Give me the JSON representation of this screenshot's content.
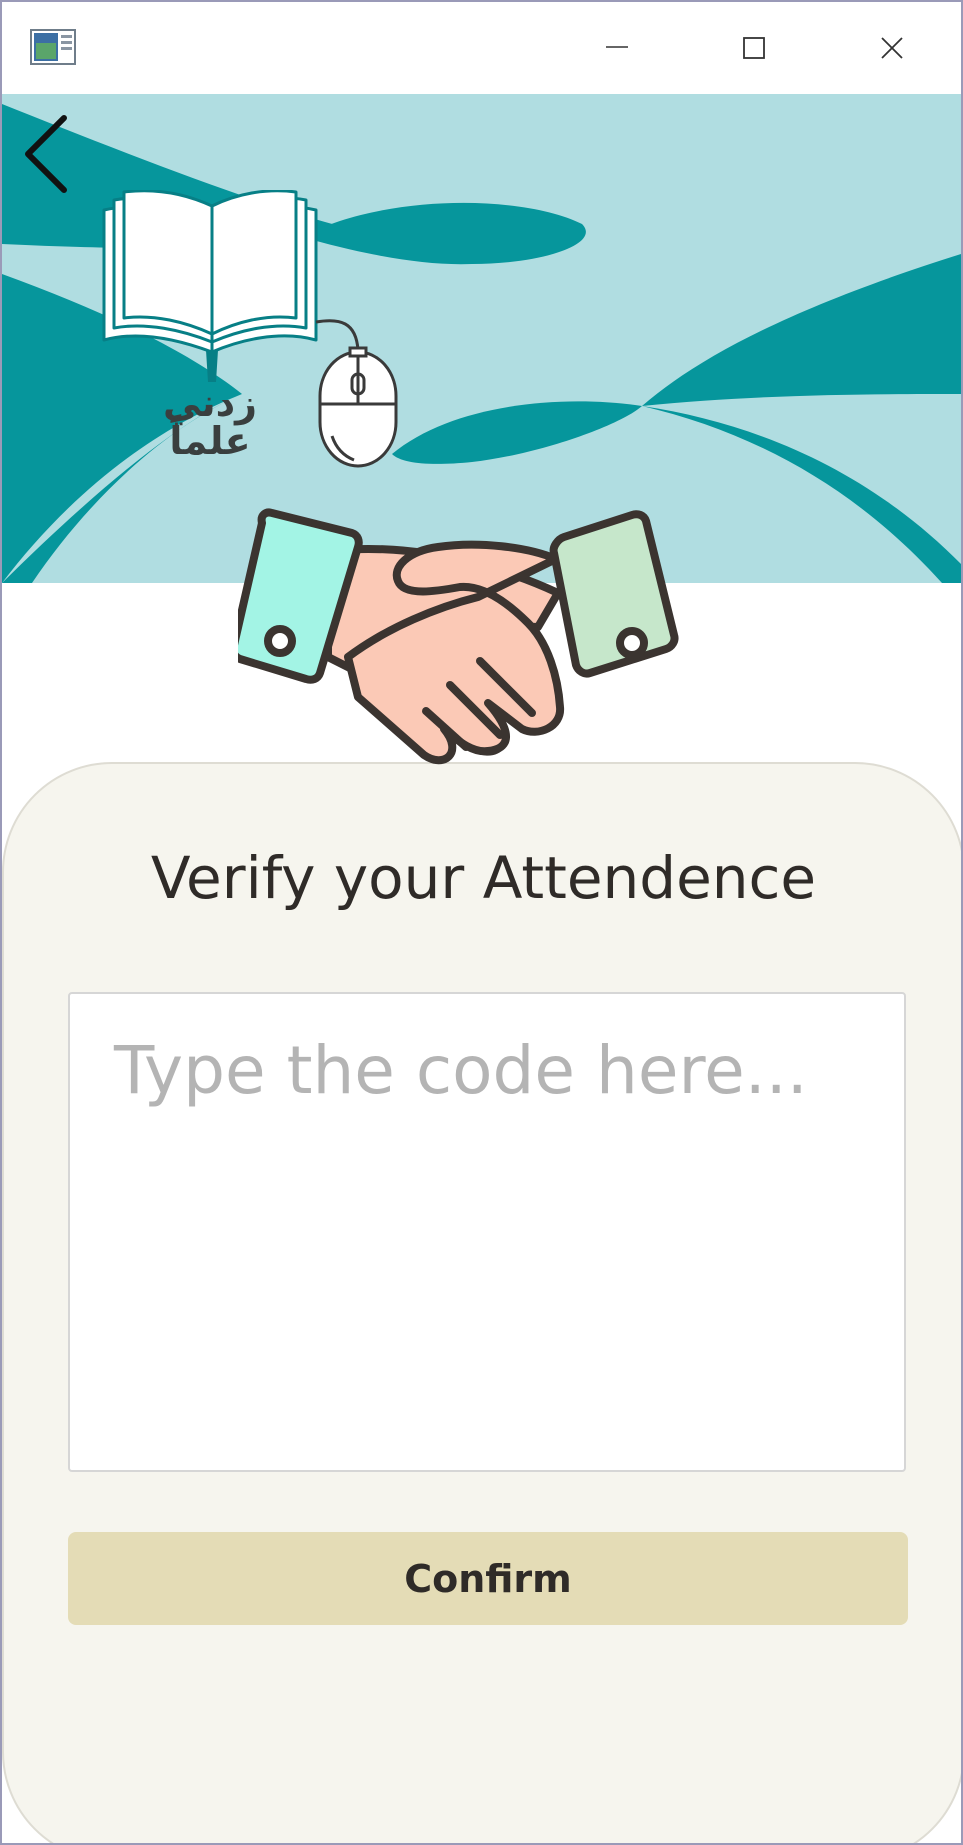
{
  "window": {
    "controls": [
      "minimize",
      "maximize",
      "close"
    ]
  },
  "header": {
    "logo_text": "زدني علماً",
    "back_icon": "chevron-left-icon"
  },
  "verify": {
    "title": "Verify your Attendence",
    "code_placeholder": "Type the code here...",
    "code_value": "",
    "confirm_label": "Confirm"
  },
  "colors": {
    "teal_dark": "#06969c",
    "teal_light": "#b0dde1",
    "card_bg": "#f6f5ee",
    "button_bg": "#e4dcb6",
    "text_dark": "#2f2b28"
  }
}
